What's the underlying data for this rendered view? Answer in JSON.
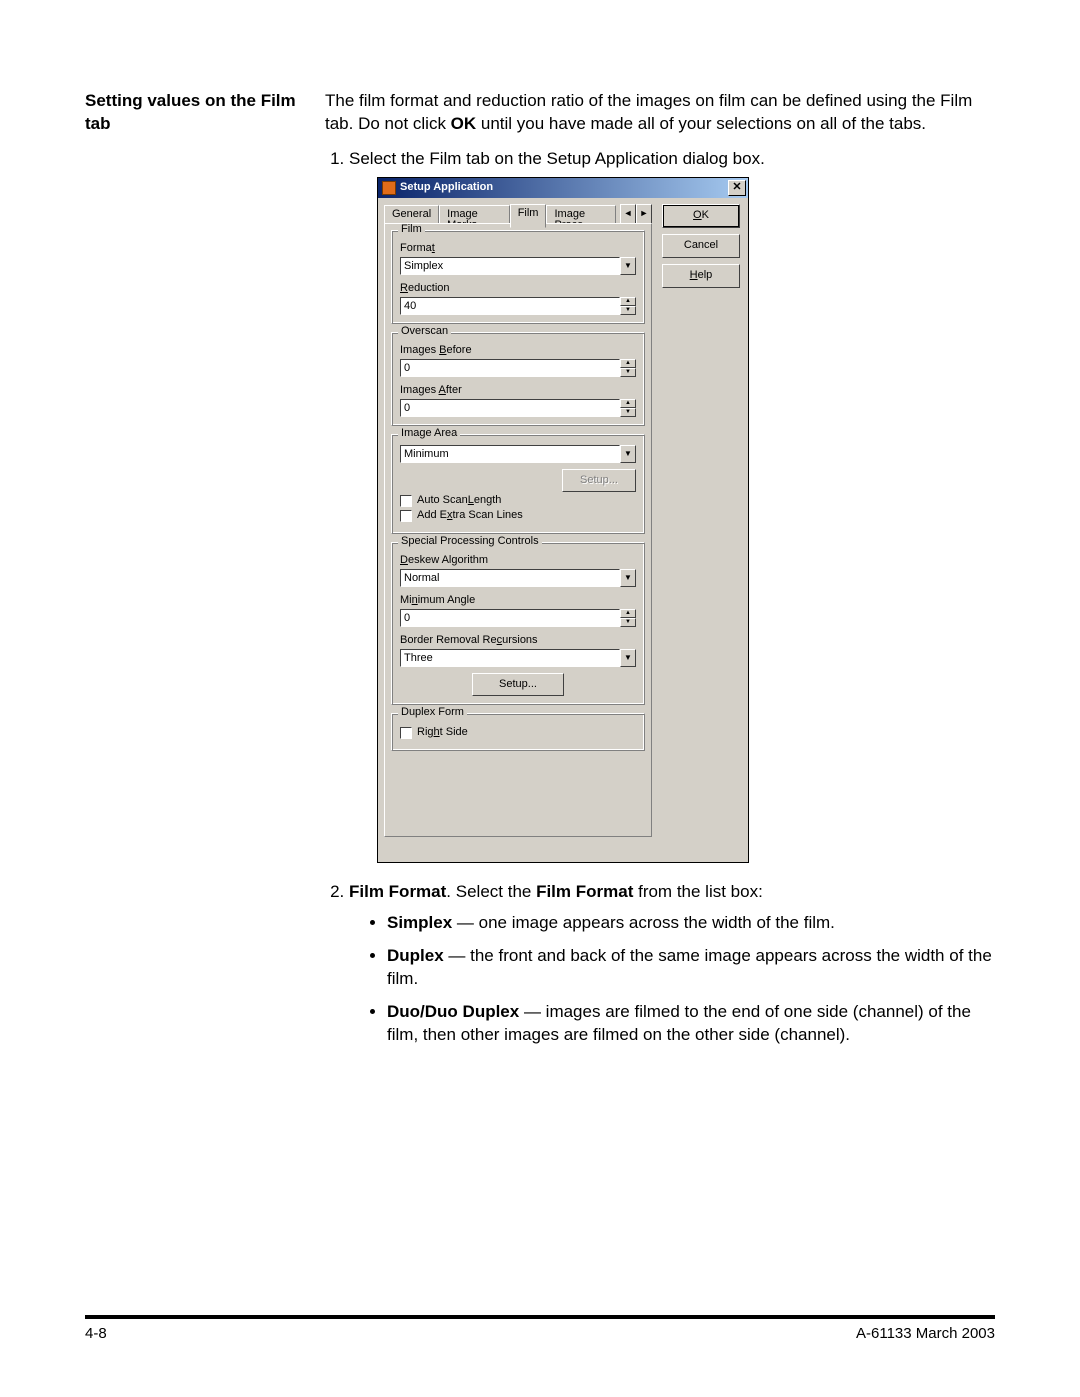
{
  "sidehead": "Setting values on the Film tab",
  "intro_pre": "The film format and reduction ratio of the images on film can be defined using the Film tab. Do not click ",
  "intro_bold": "OK",
  "intro_post": " until you have made all of your selections on all of the tabs.",
  "step1": "Select the Film tab on the Setup Application dialog box.",
  "step2_lead": "Film Format",
  "step2_mid": ". Select the ",
  "step2_lead2": "Film Format",
  "step2_tail": " from the list box:",
  "bul1_b": "Simplex",
  "bul1_t": " — one image appears across the width of the film.",
  "bul2_b": "Duplex",
  "bul2_t": " — the front and back of the same image appears across the width of the film.",
  "bul3_b": "Duo/Duo Duplex",
  "bul3_t": " — images are filmed to the end of one side (channel) of the film, then other images are filmed on the other side (channel).",
  "footer_left": "4-8",
  "footer_right": "A-61133  March 2003",
  "dialog": {
    "title": "Setup Application",
    "tabs": {
      "general": "General",
      "imagemarks": "Image Marks",
      "film": "Film",
      "imageproc": "Image Proce"
    },
    "buttons": {
      "ok": "OK",
      "ok_u": "O",
      "cancel": "Cancel",
      "help": "Help",
      "help_u": "H"
    },
    "film": {
      "legend": "Film",
      "format_lbl": "Format",
      "format_u": "t",
      "format_val": "Simplex",
      "reduction_lbl": "Reduction",
      "reduction_u": "R",
      "reduction_val": "40"
    },
    "overscan": {
      "legend": "Overscan",
      "before_lbl": "Images Before",
      "before_u": "B",
      "before_val": "0",
      "after_lbl": "Images After",
      "after_u": "A",
      "after_val": "0"
    },
    "imagearea": {
      "legend": "Image Area",
      "legend_u": "I",
      "val": "Minimum",
      "setup": "Setup...",
      "setup_u": "S",
      "auto": "Auto Scan Length",
      "auto_u": "L",
      "extra": "Add Extra Scan Lines",
      "extra_u": "x"
    },
    "special": {
      "legend": "Special Processing Controls",
      "deskew_lbl": "Deskew Algorithm",
      "deskew_u": "D",
      "deskew_val": "Normal",
      "minang_lbl": "Minimum Angle",
      "minang_u": "n",
      "minang_val": "0",
      "border_lbl": "Border Removal Recursions",
      "border_u": "c",
      "border_val": "Three",
      "setup": "Setup...",
      "setup_u": "e"
    },
    "duplex": {
      "legend": "Duplex Form",
      "legend_u": "F",
      "right": "Right Side",
      "right_u": "h"
    }
  }
}
